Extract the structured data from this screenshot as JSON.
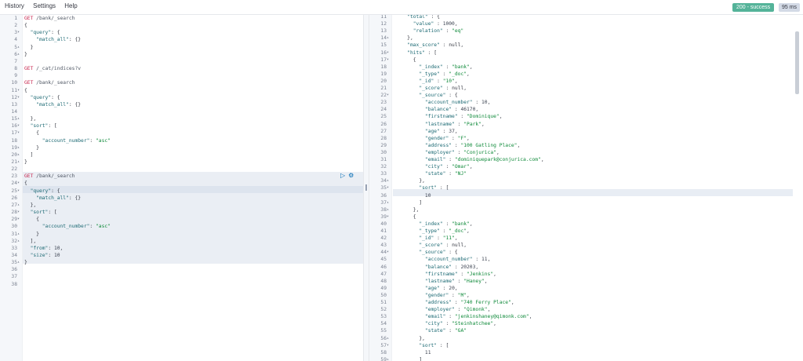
{
  "menu": {
    "history": "History",
    "settings": "Settings",
    "help": "Help"
  },
  "status": {
    "code": "200 - success",
    "time": "95 ms"
  },
  "colors": {
    "success": "#54b399",
    "method": "#c7254e",
    "key": "#1d6a74",
    "string": "#0f8a3a"
  },
  "left_editor": {
    "lines": [
      {
        "n": "1",
        "t": "GET /bank/_search",
        "f": ""
      },
      {
        "n": "2",
        "t": "{",
        "f": ""
      },
      {
        "n": "3",
        "t": "  \"query\": {",
        "f": "▾"
      },
      {
        "n": "4",
        "t": "    \"match_all\": {}",
        "f": ""
      },
      {
        "n": "5",
        "t": "  }",
        "f": "▴"
      },
      {
        "n": "6",
        "t": "}",
        "f": "▴"
      },
      {
        "n": "7",
        "t": "",
        "f": ""
      },
      {
        "n": "8",
        "t": "GET /_cat/indices?v",
        "f": ""
      },
      {
        "n": "9",
        "t": "",
        "f": ""
      },
      {
        "n": "10",
        "t": "GET /bank/_search",
        "f": ""
      },
      {
        "n": "11",
        "t": "{",
        "f": "▾"
      },
      {
        "n": "12",
        "t": "  \"query\": {",
        "f": "▾"
      },
      {
        "n": "13",
        "t": "    \"match_all\": {}",
        "f": ""
      },
      {
        "n": "14",
        "t": "",
        "f": ""
      },
      {
        "n": "15",
        "t": "  },",
        "f": "▴"
      },
      {
        "n": "16",
        "t": "  \"sort\": [",
        "f": "▾"
      },
      {
        "n": "17",
        "t": "    {",
        "f": "▾"
      },
      {
        "n": "18",
        "t": "      \"account_number\": \"asc\"",
        "f": ""
      },
      {
        "n": "19",
        "t": "    }",
        "f": "▴"
      },
      {
        "n": "20",
        "t": "  ]",
        "f": "▴"
      },
      {
        "n": "21",
        "t": "}",
        "f": "▴"
      },
      {
        "n": "22",
        "t": "",
        "f": ""
      },
      {
        "n": "23",
        "t": "GET /bank/_search",
        "f": ""
      },
      {
        "n": "24",
        "t": "{",
        "f": "▾"
      },
      {
        "n": "25",
        "t": "  \"query\": {",
        "f": "▾"
      },
      {
        "n": "26",
        "t": "    \"match_all\": {}",
        "f": ""
      },
      {
        "n": "27",
        "t": "  },",
        "f": "▴"
      },
      {
        "n": "28",
        "t": "  \"sort\": [",
        "f": "▾"
      },
      {
        "n": "29",
        "t": "    {",
        "f": "▾"
      },
      {
        "n": "30",
        "t": "      \"account_number\": \"asc\"",
        "f": ""
      },
      {
        "n": "31",
        "t": "    }",
        "f": "▴"
      },
      {
        "n": "32",
        "t": "  ],",
        "f": "▴"
      },
      {
        "n": "33",
        "t": "  \"from\": 10,",
        "f": ""
      },
      {
        "n": "34",
        "t": "  \"size\": 10",
        "f": ""
      },
      {
        "n": "35",
        "t": "}",
        "f": "▴"
      },
      {
        "n": "36",
        "t": "",
        "f": ""
      },
      {
        "n": "37",
        "t": "",
        "f": ""
      },
      {
        "n": "38",
        "t": "",
        "f": ""
      }
    ]
  },
  "right_editor": {
    "lines": [
      {
        "n": "11",
        "t": "    \"total\" : {",
        "f": ""
      },
      {
        "n": "12",
        "t": "      \"value\" : 1000,",
        "f": ""
      },
      {
        "n": "13",
        "t": "      \"relation\" : \"eq\"",
        "f": ""
      },
      {
        "n": "14",
        "t": "    },",
        "f": "▴"
      },
      {
        "n": "15",
        "t": "    \"max_score\" : null,",
        "f": ""
      },
      {
        "n": "16",
        "t": "    \"hits\" : [",
        "f": "▾"
      },
      {
        "n": "17",
        "t": "      {",
        "f": "▾"
      },
      {
        "n": "18",
        "t": "        \"_index\" : \"bank\",",
        "f": ""
      },
      {
        "n": "19",
        "t": "        \"_type\" : \"_doc\",",
        "f": ""
      },
      {
        "n": "20",
        "t": "        \"_id\" : \"10\",",
        "f": ""
      },
      {
        "n": "21",
        "t": "        \"_score\" : null,",
        "f": ""
      },
      {
        "n": "22",
        "t": "        \"_source\" : {",
        "f": "▾"
      },
      {
        "n": "23",
        "t": "          \"account_number\" : 10,",
        "f": ""
      },
      {
        "n": "24",
        "t": "          \"balance\" : 46170,",
        "f": ""
      },
      {
        "n": "25",
        "t": "          \"firstname\" : \"Dominique\",",
        "f": ""
      },
      {
        "n": "26",
        "t": "          \"lastname\" : \"Park\",",
        "f": ""
      },
      {
        "n": "27",
        "t": "          \"age\" : 37,",
        "f": ""
      },
      {
        "n": "28",
        "t": "          \"gender\" : \"F\",",
        "f": ""
      },
      {
        "n": "29",
        "t": "          \"address\" : \"100 Gatling Place\",",
        "f": ""
      },
      {
        "n": "30",
        "t": "          \"employer\" : \"Conjurica\",",
        "f": ""
      },
      {
        "n": "31",
        "t": "          \"email\" : \"dominiquepark@conjurica.com\",",
        "f": ""
      },
      {
        "n": "32",
        "t": "          \"city\" : \"Omar\",",
        "f": ""
      },
      {
        "n": "33",
        "t": "          \"state\" : \"NJ\"",
        "f": ""
      },
      {
        "n": "34",
        "t": "        },",
        "f": "▴"
      },
      {
        "n": "35",
        "t": "        \"sort\" : [",
        "f": "▾"
      },
      {
        "n": "36",
        "t": "          10",
        "f": ""
      },
      {
        "n": "37",
        "t": "        ]",
        "f": "▴"
      },
      {
        "n": "38",
        "t": "      },",
        "f": "▴"
      },
      {
        "n": "39",
        "t": "      {",
        "f": "▾"
      },
      {
        "n": "40",
        "t": "        \"_index\" : \"bank\",",
        "f": ""
      },
      {
        "n": "41",
        "t": "        \"_type\" : \"_doc\",",
        "f": ""
      },
      {
        "n": "42",
        "t": "        \"_id\" : \"11\",",
        "f": ""
      },
      {
        "n": "43",
        "t": "        \"_score\" : null,",
        "f": ""
      },
      {
        "n": "44",
        "t": "        \"_source\" : {",
        "f": "▾"
      },
      {
        "n": "45",
        "t": "          \"account_number\" : 11,",
        "f": ""
      },
      {
        "n": "46",
        "t": "          \"balance\" : 20203,",
        "f": ""
      },
      {
        "n": "47",
        "t": "          \"firstname\" : \"Jenkins\",",
        "f": ""
      },
      {
        "n": "48",
        "t": "          \"lastname\" : \"Haney\",",
        "f": ""
      },
      {
        "n": "49",
        "t": "          \"age\" : 20,",
        "f": ""
      },
      {
        "n": "50",
        "t": "          \"gender\" : \"M\",",
        "f": ""
      },
      {
        "n": "51",
        "t": "          \"address\" : \"740 Ferry Place\",",
        "f": ""
      },
      {
        "n": "52",
        "t": "          \"employer\" : \"Qimonk\",",
        "f": ""
      },
      {
        "n": "53",
        "t": "          \"email\" : \"jenkinshaney@qimonk.com\",",
        "f": ""
      },
      {
        "n": "54",
        "t": "          \"city\" : \"Steinhatchee\",",
        "f": ""
      },
      {
        "n": "55",
        "t": "          \"state\" : \"GA\"",
        "f": ""
      },
      {
        "n": "56",
        "t": "        },",
        "f": "▴"
      },
      {
        "n": "57",
        "t": "        \"sort\" : [",
        "f": "▾"
      },
      {
        "n": "58",
        "t": "          11",
        "f": ""
      },
      {
        "n": "59",
        "t": "        ]",
        "f": "▴"
      }
    ]
  }
}
